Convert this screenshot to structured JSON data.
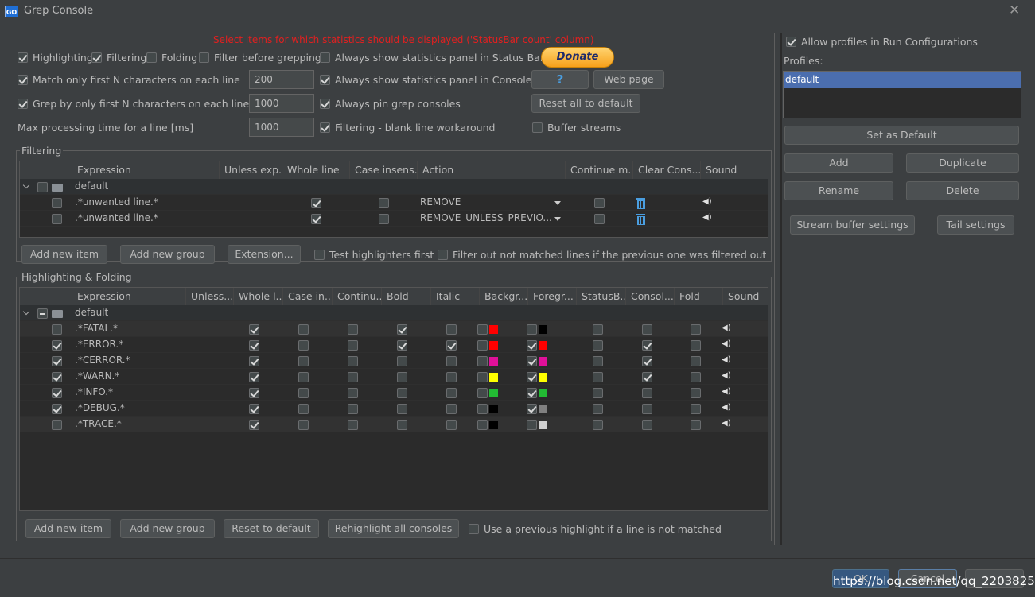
{
  "window": {
    "title": "Grep Console",
    "logo": "GO"
  },
  "top_note": "Select items for which statistics should be displayed ('StatusBar count' column)",
  "options": {
    "highlighting": "Highlighting",
    "filtering": "Filtering",
    "folding": "Folding",
    "filter_before": "Filter before grepping",
    "always_stat_status": "Always show statistics panel in Status Bar",
    "match_first_n": "Match only first N characters on each line",
    "match_first_n_value": "200",
    "always_stat_console": "Always show statistics panel in Console",
    "grep_first_n": "Grep by only first N characters on each line",
    "grep_first_n_value": "1000",
    "always_pin": "Always pin grep consoles",
    "max_time": "Max processing time for a line [ms]",
    "max_time_value": "1000",
    "blank_line": "Filtering - blank line workaround",
    "buffer_streams": "Buffer streams"
  },
  "buttons": {
    "donate": "Donate",
    "help": "?",
    "web_page": "Web page",
    "reset_all": "Reset all to default"
  },
  "filtering": {
    "title": "Filtering",
    "columns": [
      "Expression",
      "Unless exp...",
      "Whole line",
      "Case insens...",
      "Action",
      "Continue m...",
      "Clear Cons...",
      "Sound"
    ],
    "group": "default",
    "rows": [
      {
        "expr": ".*unwanted line.*",
        "action": "REMOVE"
      },
      {
        "expr": ".*unwanted line.*",
        "action": "REMOVE_UNLESS_PREVIO..."
      }
    ],
    "add_item": "Add new item",
    "add_group": "Add new group",
    "extension": "Extension...",
    "test_first": "Test highlighters first",
    "filter_out": "Filter out not matched lines if the previous one was filtered out"
  },
  "highlighting": {
    "title": "Highlighting & Folding",
    "columns": [
      "Expression",
      "Unless...",
      "Whole l...",
      "Case in...",
      "Continu...",
      "Bold",
      "Italic",
      "Backgr...",
      "Foregr...",
      "StatusB...",
      "Consol...",
      "Fold",
      "Sound"
    ],
    "group": "default",
    "rows": [
      {
        "expr": ".*FATAL.*",
        "bg": "#ff0000",
        "fg": "#000000"
      },
      {
        "expr": ".*ERROR.*",
        "bg": "#ff0000",
        "fg": "#ff0000"
      },
      {
        "expr": ".*CERROR.*",
        "bg": "#e0109a",
        "fg": "#e0109a"
      },
      {
        "expr": ".*WARN.*",
        "bg": "#ffff00",
        "fg": "#ffff00"
      },
      {
        "expr": ".*INFO.*",
        "bg": "#22bb33",
        "fg": "#22bb33"
      },
      {
        "expr": ".*DEBUG.*",
        "bg": "#000000",
        "fg": "#808080"
      },
      {
        "expr": ".*TRACE.*",
        "bg": "#000000",
        "fg": "#d0d0d0"
      }
    ],
    "add_item": "Add new item",
    "add_group": "Add new group",
    "reset": "Reset to default",
    "rehighlight": "Rehighlight all consoles",
    "use_previous": "Use a previous highlight if a line is not matched"
  },
  "profiles": {
    "allow": "Allow profiles in Run Configurations",
    "label": "Profiles:",
    "items": [
      "default"
    ],
    "set_default": "Set as Default",
    "add": "Add",
    "duplicate": "Duplicate",
    "rename": "Rename",
    "delete": "Delete",
    "stream_buffer": "Stream buffer settings",
    "tail": "Tail settings"
  },
  "footer": {
    "ok": "OK",
    "cancel": "Cancel",
    "watermark": "https://blog.csdn.net/qq_22038259"
  }
}
